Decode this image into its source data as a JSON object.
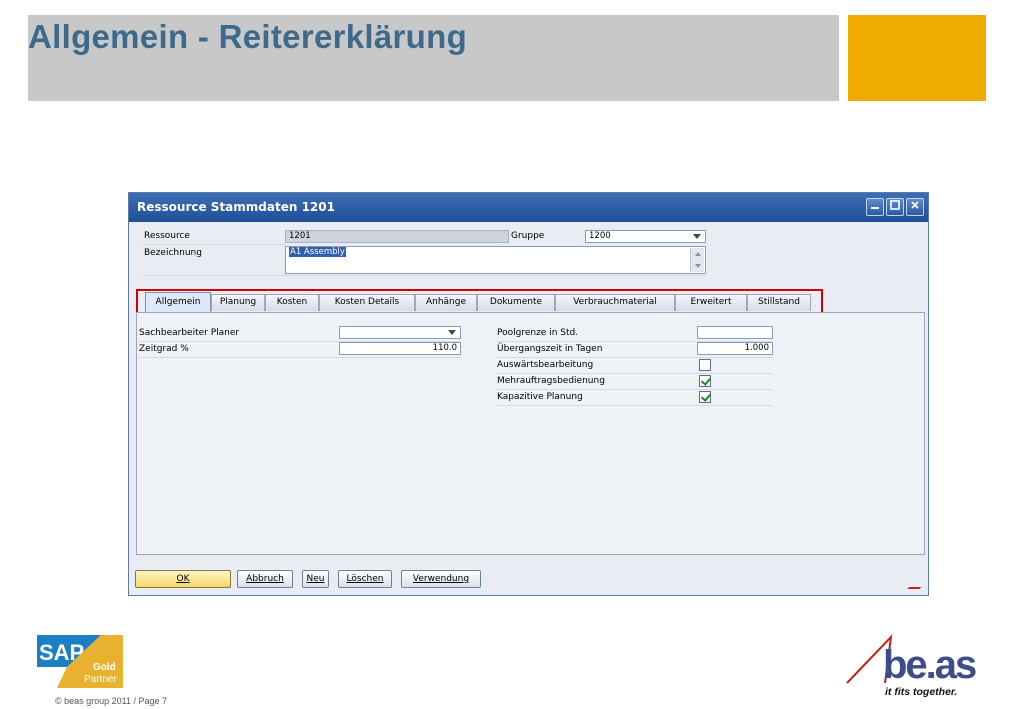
{
  "slide": {
    "title": "Allgemein - Reitererklärung",
    "footer": "© beas group 2011 / Page 7",
    "colors": {
      "title": "#3d6a8a",
      "band": "#c8c8c8",
      "accent": "#f0ab00",
      "highlight": "#d40000"
    }
  },
  "window": {
    "title": "Ressource Stammdaten 1201",
    "controls": [
      "minimize-icon",
      "maximize-icon",
      "close-icon"
    ]
  },
  "header": {
    "ressource_label": "Ressource",
    "ressource_value": "1201",
    "gruppe_label": "Gruppe",
    "gruppe_value": "1200",
    "bezeichnung_label": "Bezeichnung",
    "bezeichnung_value": "A1 Assembly"
  },
  "tabs": [
    {
      "label": "Allgemein",
      "active": true
    },
    {
      "label": "Planung"
    },
    {
      "label": "Kosten"
    },
    {
      "label": "Kosten Details"
    },
    {
      "label": "Anhänge"
    },
    {
      "label": "Dokumente"
    },
    {
      "label": "Verbrauchmaterial"
    },
    {
      "label": "Erweitert"
    },
    {
      "label": "Stillstand"
    }
  ],
  "general": {
    "sachbearbeiter_label": "Sachbearbeiter Planer",
    "sachbearbeiter_value": "",
    "zeitgrad_label": "Zeitgrad %",
    "zeitgrad_value": "110.0",
    "poolgrenze_label": "Poolgrenze in Std.",
    "poolgrenze_value": "",
    "uebergang_label": "Übergangszeit in Tagen",
    "uebergang_value": "1.000",
    "auswaerts_label": "Auswärtsbearbeitung",
    "auswaerts_checked": false,
    "mehrauftrag_label": "Mehrauftragsbedienung",
    "mehrauftrag_checked": true,
    "kapazitiv_label": "Kapazitive Planung",
    "kapazitiv_checked": true
  },
  "buttons": {
    "ok": "OK",
    "abbruch": "Abbruch",
    "neu": "Neu",
    "loeschen": "Löschen",
    "verwendung": "Verwendung"
  },
  "logos": {
    "sap": {
      "text": "SAP",
      "badge_line1": "Gold",
      "badge_line2": "Partner"
    },
    "beas": {
      "text": "be.as",
      "tagline": "it fits together."
    }
  }
}
